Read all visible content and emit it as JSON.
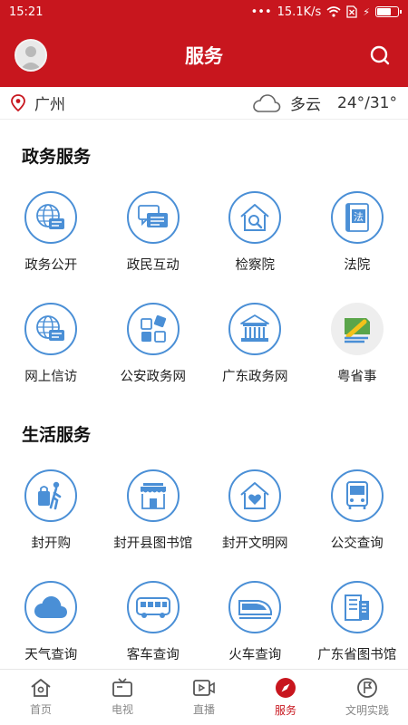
{
  "status": {
    "time": "15:21",
    "dots": "•••",
    "speed": "15.1K/s"
  },
  "header": {
    "title": "服务"
  },
  "weather": {
    "city": "广州",
    "condition": "多云",
    "temp": "24°/31°"
  },
  "gov": {
    "title": "政务服务",
    "items": [
      {
        "label": "政务公开",
        "icon": "globe-chat-icon"
      },
      {
        "label": "政民互动",
        "icon": "chat-bubbles-icon"
      },
      {
        "label": "检察院",
        "icon": "house-search-icon"
      },
      {
        "label": "法院",
        "icon": "law-book-icon"
      },
      {
        "label": "网上信访",
        "icon": "globe-chat-icon"
      },
      {
        "label": "公安政务网",
        "icon": "blocks-icon"
      },
      {
        "label": "广东政务网",
        "icon": "government-building-icon"
      },
      {
        "label": "粤省事",
        "icon": "yueshengshi-logo"
      }
    ]
  },
  "life": {
    "title": "生活服务",
    "items": [
      {
        "label": "封开购",
        "icon": "shopper-icon"
      },
      {
        "label": "封开县图书馆",
        "icon": "storefront-icon"
      },
      {
        "label": "封开文明网",
        "icon": "house-heart-icon"
      },
      {
        "label": "公交查询",
        "icon": "bus-front-icon"
      },
      {
        "label": "天气查询",
        "icon": "cloud-icon"
      },
      {
        "label": "客车查询",
        "icon": "coach-icon"
      },
      {
        "label": "火车查询",
        "icon": "train-icon"
      },
      {
        "label": "广东省图书馆",
        "icon": "library-building-icon"
      }
    ]
  },
  "tabs": [
    {
      "label": "首页",
      "icon": "home-icon"
    },
    {
      "label": "电视",
      "icon": "tv-icon"
    },
    {
      "label": "直播",
      "icon": "live-video-icon"
    },
    {
      "label": "服务",
      "icon": "compass-icon",
      "active": true
    },
    {
      "label": "文明实践",
      "icon": "flag-circle-icon"
    }
  ],
  "colors": {
    "brand": "#c8161e",
    "icon_blue": "#4a8fd6"
  }
}
